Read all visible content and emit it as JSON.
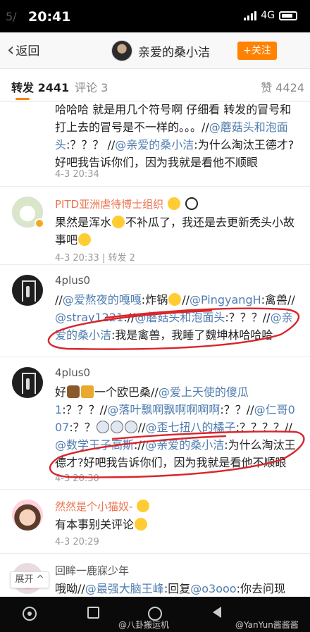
{
  "status": {
    "time": "20:41",
    "ghost": "5/",
    "network": "4G"
  },
  "nav": {
    "back_label": "返回",
    "title": "亲爱的桑小洁",
    "follow_label": "+关注"
  },
  "tabs": {
    "repost": "转发",
    "repost_count": "2441",
    "comment": "评论 3",
    "like": "赞 4424"
  },
  "items": [
    {
      "body_parts": [
        {
          "t": "哈哈哈 就是用几个符号啊 仔细看 转发的冒号和打上去的冒号是不一样的。。。//"
        },
        {
          "t": "@蘑菇头和泡面头",
          "link": true
        },
        {
          "t": ":？？？ //"
        },
        {
          "t": "@亲爱的桑小洁",
          "link": true
        },
        {
          "t": ":为什么淘汰王德才?好吧我告诉你们，因为我就是看他不顺眼"
        }
      ],
      "meta": "4-3 20:34"
    },
    {
      "name": "PITD亚洲虐待博士组织",
      "body_parts": [
        {
          "t": "果然是浑水"
        },
        {
          "emo": "laugh"
        },
        {
          "t": "不补瓜了，我还是去更新秃头小故事吧"
        },
        {
          "emo": "laugh"
        }
      ],
      "meta": "4-3 20:33 | 转发 2"
    },
    {
      "name": "4plus0",
      "body_parts": [
        {
          "t": "//"
        },
        {
          "t": "@爱熬夜的嘎嘎",
          "link": true
        },
        {
          "t": ":炸锅"
        },
        {
          "emo": "shock"
        },
        {
          "t": "//"
        },
        {
          "t": "@PingyangH",
          "link": true
        },
        {
          "t": ":禽兽//"
        },
        {
          "t": "@stray1221",
          "link": true
        },
        {
          "t": "://"
        },
        {
          "t": "@蘑菇头和泡面头",
          "link": true
        },
        {
          "t": ":？？？//"
        },
        {
          "t": "@亲爱的桑小洁",
          "link": true
        },
        {
          "t": ":我是禽兽，我睡了魏坤林哈哈哈"
        }
      ],
      "meta": ""
    },
    {
      "name": "4plus0",
      "body_parts": [
        {
          "t": "好"
        },
        {
          "emo": "cow"
        },
        {
          "emo": "beer"
        },
        {
          "t": "一个欧巴桑//"
        },
        {
          "t": "@爱上天使的傻瓜1",
          "link": true
        },
        {
          "t": ":？？？//"
        },
        {
          "t": "@落叶飘啊飘啊啊啊啊",
          "link": true
        },
        {
          "t": ":？？//"
        },
        {
          "t": "@仁哥007",
          "link": true
        },
        {
          "t": ":？？"
        },
        {
          "emo": "face"
        },
        {
          "emo": "face"
        },
        {
          "emo": "face"
        },
        {
          "t": "//"
        },
        {
          "t": "@歪七扭八的橘子",
          "link": true
        },
        {
          "t": ":？？？？//"
        },
        {
          "t": "@数学王子高斯",
          "link": true
        },
        {
          "t": "://"
        },
        {
          "t": "@亲爱的桑小洁",
          "link": true
        },
        {
          "t": ":为什么淘汰王德才?好吧我告诉你们，因为我就是看他不顺眼"
        }
      ],
      "meta": "4-3 20:30"
    },
    {
      "name": "然然是个小猫奴-",
      "body_parts": [
        {
          "t": "有本事别关评论"
        },
        {
          "emo": "grin"
        }
      ],
      "meta": "4-3 20:29"
    },
    {
      "name": "回眸一鹿寐少年",
      "body_parts": [
        {
          "t": "哦呦//"
        },
        {
          "t": "@最强大脑王峰",
          "link": true
        },
        {
          "t": ":回复"
        },
        {
          "t": "@o3ooo",
          "link": true
        },
        {
          "t": ":你去问现"
        }
      ],
      "meta": ""
    }
  ],
  "unfold_label": "展开",
  "watermarks": {
    "left": "@八卦搬运机",
    "right": "@YanYun酱酱酱"
  },
  "colors": {
    "accent": "#ff8200",
    "link": "#507daf",
    "orange_name": "#eb7350",
    "annotation": "#d9252b"
  }
}
